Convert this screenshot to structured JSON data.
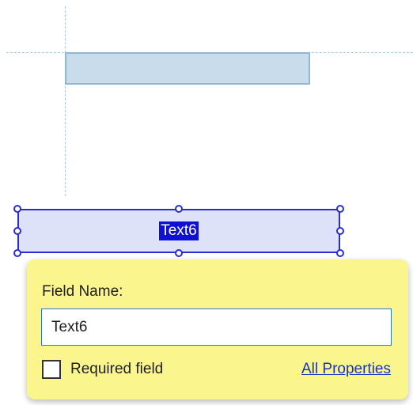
{
  "selected_field": {
    "text": "Text6"
  },
  "popup": {
    "field_name_label": "Field Name:",
    "field_name_value": "Text6",
    "required_label": "Required field",
    "required_checked": false,
    "all_properties_link": "All Properties"
  },
  "colors": {
    "selection_border": "#2b2bd6",
    "selection_fill": "#dde2f8",
    "existing_field_fill": "#c8dceb",
    "popup_background": "#fbf58e",
    "link": "#1a33c4"
  }
}
